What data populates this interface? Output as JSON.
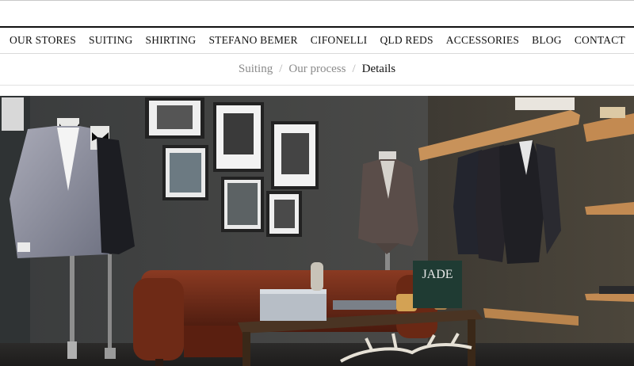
{
  "nav": {
    "items": [
      "OUR STORES",
      "SUITING",
      "SHIRTING",
      "STEFANO BEMER",
      "CIFONELLI",
      "QLD REDS",
      "ACCESSORIES",
      "BLOG",
      "CONTACT"
    ]
  },
  "breadcrumb": {
    "items": [
      "Suiting",
      "Our process"
    ],
    "separator": "/",
    "current": "Details"
  },
  "hero": {
    "book_title": "JADE"
  },
  "colors": {
    "nav_border": "#111111",
    "breadcrumb_link": "#8a8a8a",
    "breadcrumb_current": "#111111"
  }
}
